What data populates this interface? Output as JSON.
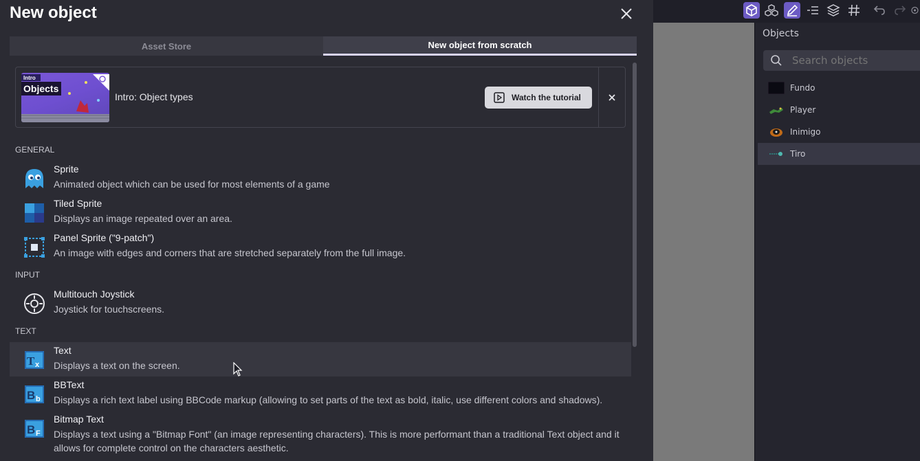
{
  "dialog": {
    "title": "New object",
    "close_icon": "close-icon",
    "tabs": [
      {
        "label": "Asset Store",
        "active": false
      },
      {
        "label": "New object from scratch",
        "active": true
      }
    ]
  },
  "tutorial": {
    "thumb_badge": "Intro",
    "thumb_title": "Objects",
    "title": "Intro: Object types",
    "watch_label": "Watch the tutorial"
  },
  "sections": {
    "general": "GENERAL",
    "input": "INPUT",
    "text": "TEXT"
  },
  "items": [
    {
      "name": "Sprite",
      "desc": "Animated object which can be used for most elements of a game",
      "icon": "sprite-icon"
    },
    {
      "name": "Tiled Sprite",
      "desc": "Displays an image repeated over an area.",
      "icon": "tiled-sprite-icon"
    },
    {
      "name": "Panel Sprite (\"9-patch\")",
      "desc": "An image with edges and corners that are stretched separately from the full image.",
      "icon": "panel-sprite-icon"
    },
    {
      "name": "Multitouch Joystick",
      "desc": "Joystick for touchscreens.",
      "icon": "joystick-icon"
    },
    {
      "name": "Text",
      "desc": "Displays a text on the screen.",
      "icon": "text-icon"
    },
    {
      "name": "BBText",
      "desc": "Displays a rich text label using BBCode markup (allowing to set parts of the text as bold, italic, use different colors and shadows).",
      "icon": "bbtext-icon"
    },
    {
      "name": "Bitmap Text",
      "desc": "Displays a text using a \"Bitmap Font\" (an image representing characters). This is more performant than a traditional Text object and it allows for complete control on the characters aesthetic.",
      "icon": "bitmap-text-icon"
    }
  ],
  "objects_panel": {
    "title": "Objects",
    "search_placeholder": "Search objects",
    "objects": [
      {
        "name": "Fundo",
        "selected": false
      },
      {
        "name": "Player",
        "selected": false
      },
      {
        "name": "Inimigo",
        "selected": false
      },
      {
        "name": "Tiro",
        "selected": true
      }
    ]
  },
  "colors": {
    "accent": "#6c5bc4",
    "dialog_bg": "#2b2b33",
    "tab_active_underline": "#d8d4f5",
    "icon_blue": "#3a9fd8"
  }
}
